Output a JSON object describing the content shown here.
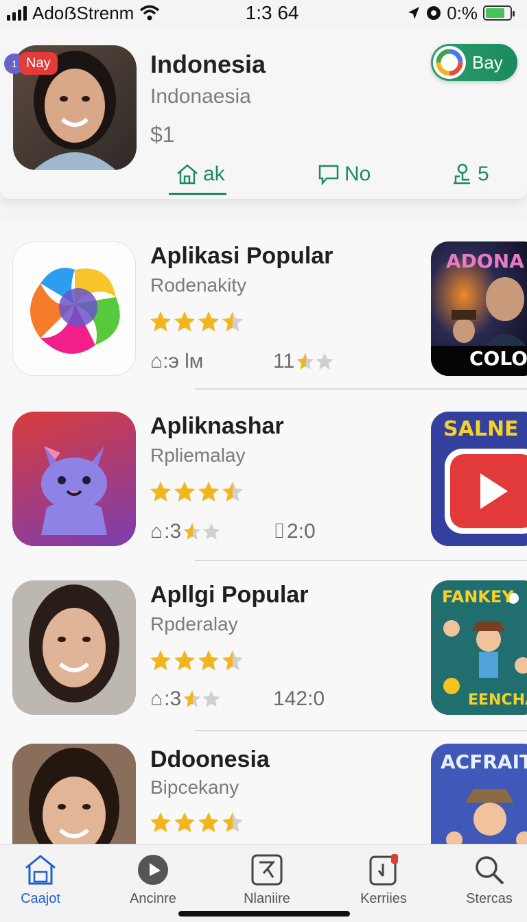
{
  "status_bar": {
    "carrier": "AdoẞStrenm",
    "time": "1:3 64",
    "battery": "0:%",
    "battery_level": 0.8
  },
  "featured": {
    "badge": "Nay",
    "corner_badge": "1",
    "title": "Indonesia",
    "subtitle": "Indonaesia",
    "price": "$1",
    "get_button": "Bay",
    "tabs": [
      {
        "label": "ak",
        "icon": "home-outline-icon"
      },
      {
        "label": "No",
        "icon": "speech-bubble-icon"
      },
      {
        "label": "5",
        "icon": "person-stand-icon"
      }
    ]
  },
  "apps": [
    {
      "name": "Aplikasi Popular",
      "category": "Rodenakity",
      "rating": 3.5,
      "meta_a": "⌂:э lм",
      "meta_b": "11",
      "meta_b_stars": 2,
      "meta_a_stars": 0,
      "promo_text_top": "ADONA",
      "promo_text_bottom": "COLO"
    },
    {
      "name": "Apliknashar",
      "category": "Rpliemalay",
      "rating": 3.5,
      "meta_a": ":3",
      "meta_a_stars": 2,
      "meta_b": "2:0",
      "meta_b_prefix": "⌷",
      "promo_text_top": "SALNE",
      "promo_text_bottom": ""
    },
    {
      "name": "Apllgi Popular",
      "category": "Rpderalay",
      "rating": 3.5,
      "meta_a": ":3",
      "meta_a_stars": 2,
      "meta_b": "142:0",
      "promo_text_top": "FANKEY",
      "promo_text_bottom": "EENCHA"
    },
    {
      "name": "Ddoonesia",
      "category": "Bipcekany",
      "rating": 3.5,
      "promo_text_top": "ACFRAIT",
      "promo_text_bottom": ""
    }
  ],
  "tab_bar": [
    {
      "label": "Caajot",
      "icon": "home-icon",
      "active": true
    },
    {
      "label": "Ancinre",
      "icon": "compass-play-icon",
      "active": false
    },
    {
      "label": "Nlaniire",
      "icon": "arcade-icon",
      "active": false
    },
    {
      "label": "Kerriies",
      "icon": "updates-icon",
      "active": false
    },
    {
      "label": "Stercas",
      "icon": "search-icon",
      "active": false
    }
  ],
  "colors": {
    "accent_green": "#1e8a62",
    "tab_active": "#1d5fd0",
    "star": "#f2b51d",
    "badge_red": "#e33a3a"
  }
}
